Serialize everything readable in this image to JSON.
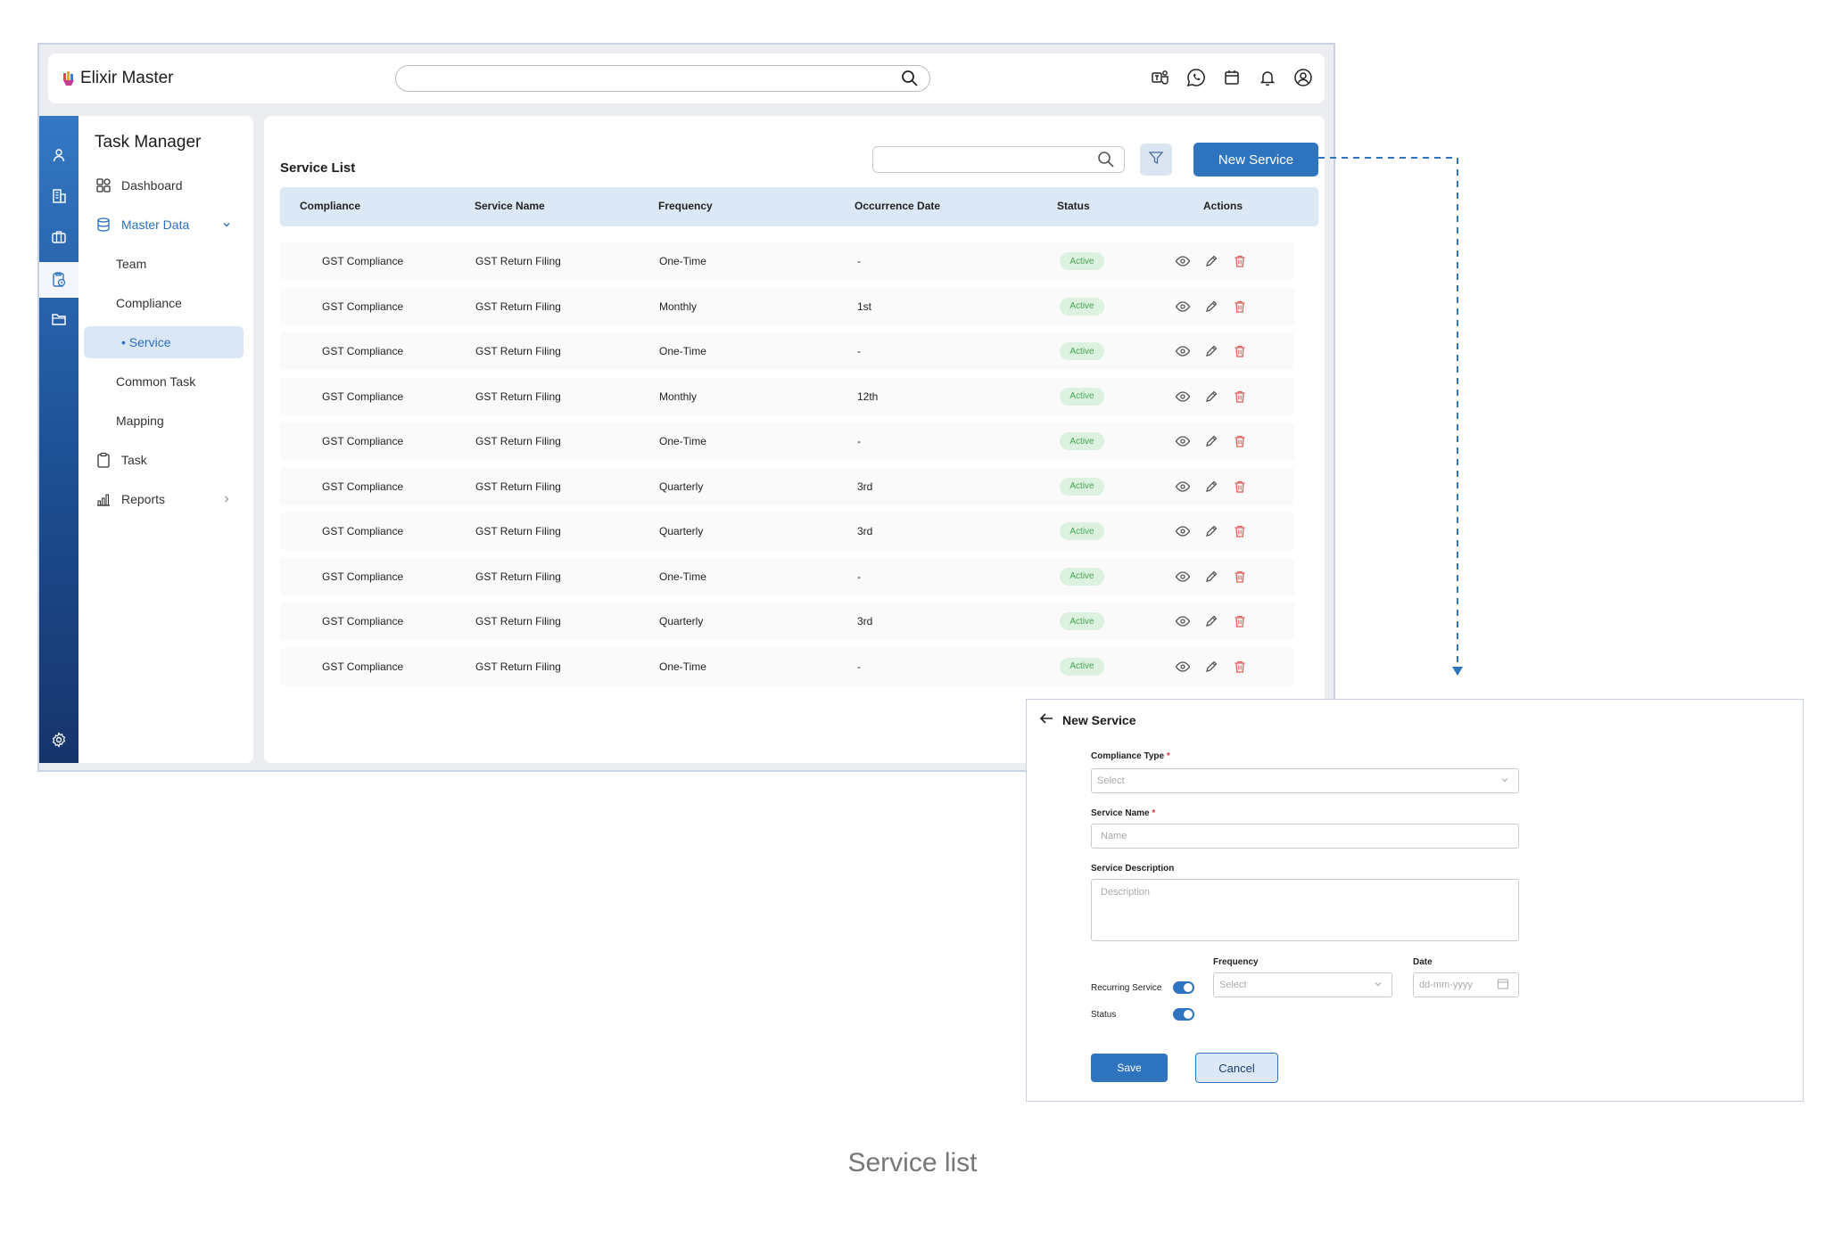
{
  "app": {
    "brand": "Elixir Master",
    "search_placeholder": "",
    "top_icons": [
      "teams-icon",
      "whatsapp-icon",
      "calendar-icon",
      "bell-icon",
      "user-circle-icon"
    ]
  },
  "sidenav": {
    "title": "Task Manager",
    "items": [
      {
        "label": "Dashboard",
        "icon": "dashboard-icon"
      },
      {
        "label": "Master Data",
        "icon": "database-icon"
      },
      {
        "label": "Team"
      },
      {
        "label": "Compliance"
      },
      {
        "label": "• Service"
      },
      {
        "label": "Common Task"
      },
      {
        "label": "Mapping"
      },
      {
        "label": "Task",
        "icon": "clipboard-icon"
      },
      {
        "label": "Reports",
        "icon": "bar-chart-icon"
      }
    ]
  },
  "list": {
    "title": "Service List",
    "search_placeholder": "",
    "new_button": "New Service",
    "columns": [
      "Compliance",
      "Service Name",
      "Frequency",
      "Occurrence Date",
      "Status",
      "Actions"
    ],
    "rows": [
      {
        "compliance": "GST Compliance",
        "service": "GST Return Filing",
        "frequency": "One-Time",
        "date": "-",
        "status": "Active"
      },
      {
        "compliance": "GST Compliance",
        "service": "GST Return Filing",
        "frequency": "Monthly",
        "date": "1st",
        "status": "Active"
      },
      {
        "compliance": "GST Compliance",
        "service": "GST Return Filing",
        "frequency": "One-Time",
        "date": "-",
        "status": "Active"
      },
      {
        "compliance": "GST Compliance",
        "service": "GST Return Filing",
        "frequency": "Monthly",
        "date": "12th",
        "status": "Active"
      },
      {
        "compliance": "GST Compliance",
        "service": "GST Return Filing",
        "frequency": "One-Time",
        "date": "-",
        "status": "Active"
      },
      {
        "compliance": "GST Compliance",
        "service": "GST Return Filing",
        "frequency": "Quarterly",
        "date": "3rd",
        "status": "Active"
      },
      {
        "compliance": "GST Compliance",
        "service": "GST Return Filing",
        "frequency": "Quarterly",
        "date": "3rd",
        "status": "Active"
      },
      {
        "compliance": "GST Compliance",
        "service": "GST Return Filing",
        "frequency": "One-Time",
        "date": "-",
        "status": "Active"
      },
      {
        "compliance": "GST Compliance",
        "service": "GST Return Filing",
        "frequency": "Quarterly",
        "date": "3rd",
        "status": "Active"
      },
      {
        "compliance": "GST Compliance",
        "service": "GST Return Filing",
        "frequency": "One-Time",
        "date": "-",
        "status": "Active"
      }
    ]
  },
  "form": {
    "title": "New Service",
    "compliance_type_label": "Compliance Type",
    "compliance_type_placeholder": "Select",
    "service_name_label": "Service Name",
    "service_name_placeholder": "Name",
    "description_label": "Service Description",
    "description_placeholder": "Description",
    "frequency_label": "Frequency",
    "frequency_placeholder": "Select",
    "date_label": "Date",
    "date_placeholder": "dd-mm-yyyy",
    "recurring_label": "Recurring Service",
    "recurring_on": true,
    "status_label": "Status",
    "status_on": true,
    "required_mark": "*",
    "save_label": "Save",
    "cancel_label": "Cancel"
  },
  "caption": "Service list",
  "colors": {
    "primary": "#2f74bf",
    "rail_top": "#3478c4",
    "rail_bottom": "#17346b",
    "header_bg": "#dde8f6",
    "active_badge_bg": "#dcf1df",
    "active_badge_text": "#45a552",
    "delete_icon": "#e0605a"
  }
}
